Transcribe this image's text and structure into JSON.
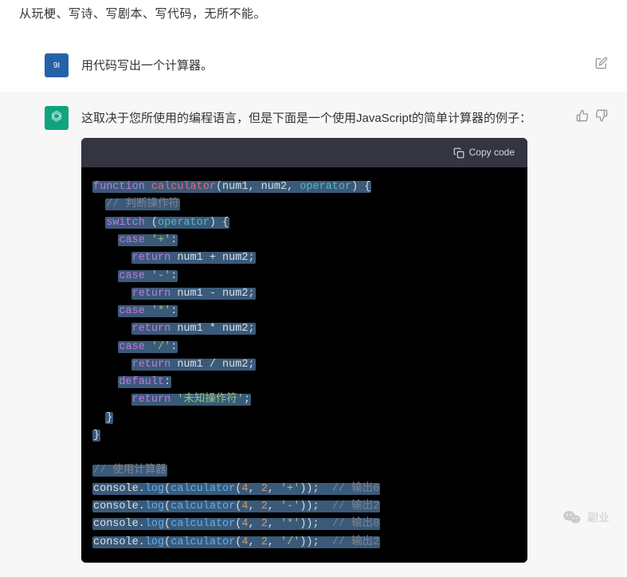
{
  "intro": "从玩梗、写诗、写剧本、写代码，无所不能。",
  "user": {
    "avatar_label": "9I",
    "message": "用代码写出一个计算器。"
  },
  "assistant": {
    "message": "这取决于您所使用的编程语言，但是下面是一个使用JavaScript的简单计算器的例子：",
    "copy_label": "Copy code"
  },
  "code": {
    "l1_kw": "function",
    "l1_fn": "calculator",
    "l1_p1": "num1",
    "l1_p2": "num2",
    "l1_p3": "operator",
    "l2_com": "// 判断操作符",
    "l3_kw": "switch",
    "l3_param": "operator",
    "l4_case": "case",
    "l4_str": "'+'",
    "l5_ret": "return",
    "l5_exp": "num1 + num2;",
    "l6_case": "case",
    "l6_str": "'-'",
    "l7_ret": "return",
    "l7_exp": "num1 - num2;",
    "l8_case": "case",
    "l8_str": "'*'",
    "l9_ret": "return",
    "l9_exp": "num1 * num2;",
    "l10_case": "case",
    "l10_str": "'/'",
    "l11_ret": "return",
    "l11_exp": "num1 / num2;",
    "l12_def": "default",
    "l13_ret": "return",
    "l13_str": "'未知操作符'",
    "l18_com": "// 使用计算器",
    "c1_obj": "console",
    "c1_m": "log",
    "c1_fn": "calculator",
    "c1_a1": "4",
    "c1_a2": "2",
    "c1_a3": "'+'",
    "c1_com": "// 输出6",
    "c2_a1": "4",
    "c2_a2": "2",
    "c2_a3": "'-'",
    "c2_com": "// 输出2",
    "c3_a1": "4",
    "c3_a2": "2",
    "c3_a3": "'*'",
    "c3_com": "// 输出8",
    "c4_a1": "4",
    "c4_a2": "2",
    "c4_a3": "'/'",
    "c4_com": "// 输出2"
  },
  "watermark": "副业"
}
